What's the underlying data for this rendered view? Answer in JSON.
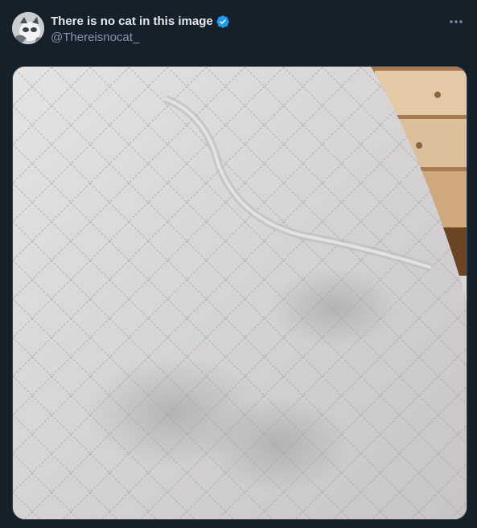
{
  "author": {
    "display_name": "There is no cat in this image",
    "handle": "@Thereisnocat_",
    "verified": true
  },
  "icons": {
    "verified": "verified-badge-icon",
    "more": "more-horizontal-icon"
  },
  "colors": {
    "background": "#15202b",
    "primary_text": "#e7e9ea",
    "secondary_text": "#8b98a5",
    "verified_blue": "#1d9bf0"
  }
}
